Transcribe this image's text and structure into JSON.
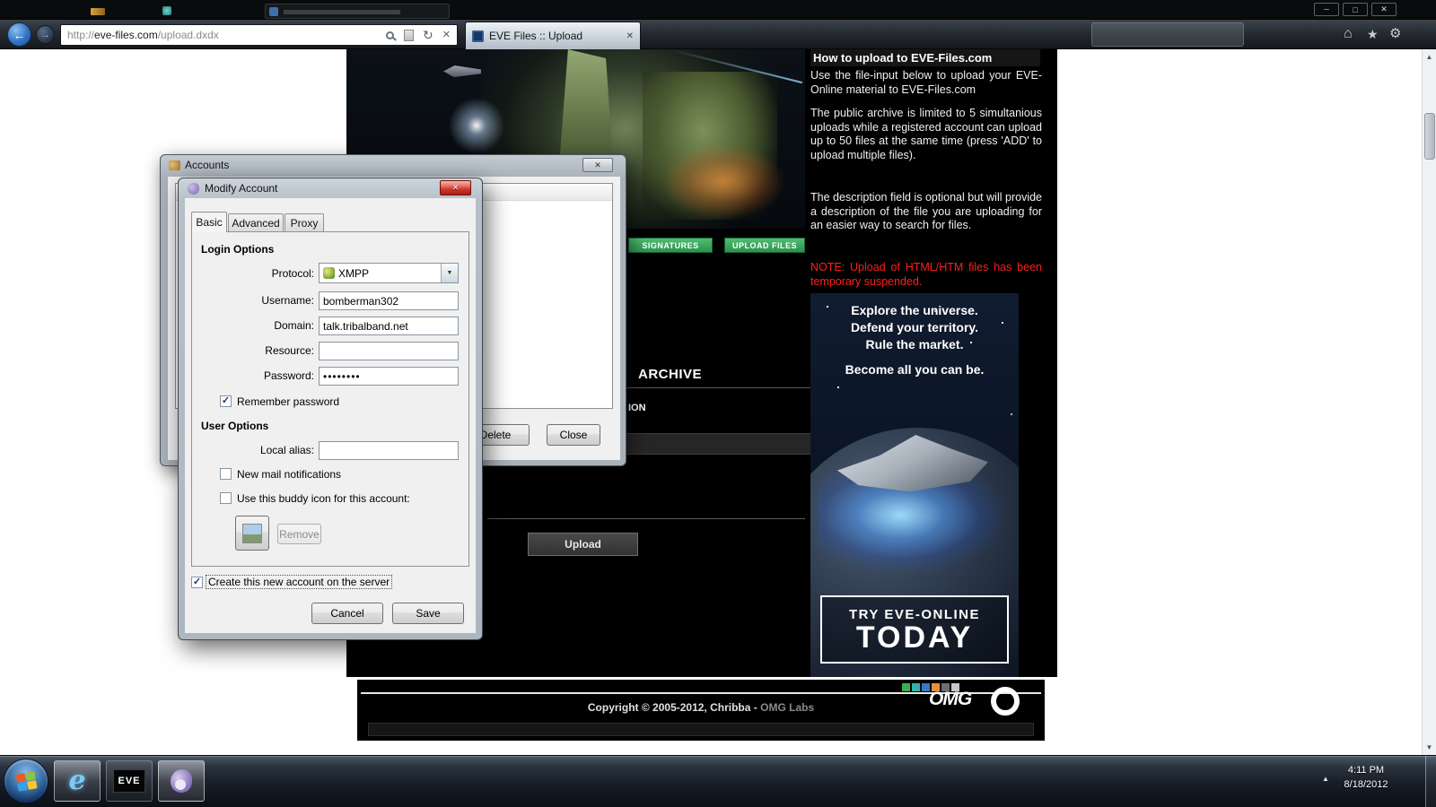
{
  "icons": {
    "minimize": "─",
    "maximize": "□",
    "close": "✕",
    "back_arrow": "←",
    "forward_arrow": "→",
    "refresh": "↻",
    "stop": "✕",
    "home": "⌂",
    "favorites_star": "★",
    "gear": "⚙",
    "dropdown_arrow": "▼",
    "checkmark": "✓",
    "scroll_up": "▲",
    "scroll_down": "▼",
    "tray_expand": "▲"
  },
  "browser": {
    "url_scheme": "http://",
    "url_host": "eve-files.com",
    "url_path": "/upload.dxdx",
    "tab_title": "EVE Files :: Upload"
  },
  "page": {
    "nav": {
      "signatures": "SIGNATURES",
      "upload_files": "UPLOAD FILES"
    },
    "archive_heading": "ARCHIVE",
    "description_partial": "ION",
    "upload_button": "Upload",
    "sidebar": {
      "heading": "How to upload to EVE-Files.com",
      "p1": "Use the file-input below to upload your EVE-Online material to EVE-Files.com",
      "p2": "The public archive is limited to 5 simultanious uploads while a registered account can upload up to 50 files at the same time (press 'ADD' to upload multiple files).",
      "p3": "The description field is optional but will provide a description of the file you are uploading for an easier way to search for files.",
      "note": "NOTE: Upload of HTML/HTM files has been temporary suspended."
    },
    "ad": {
      "line1": "Explore the universe.",
      "line2": "Defend your territory.",
      "line3": "Rule the market.",
      "line4": "Become all you can be.",
      "cta_line1": "TRY EVE-ONLINE",
      "cta_line2": "TODAY"
    },
    "footer": {
      "copyright": "Copyright © 2005-2012, Chribba -",
      "omg_labs": "OMG Labs",
      "omg_logo": "OMG"
    }
  },
  "accounts_window": {
    "title": "Accounts",
    "delete_button": "Delete",
    "close_button": "Close"
  },
  "modify_dialog": {
    "title": "Modify Account",
    "tabs": [
      "Basic",
      "Advanced",
      "Proxy"
    ],
    "login_heading": "Login Options",
    "protocol_label": "Protocol:",
    "protocol_value": "XMPP",
    "username_label": "Username:",
    "username_value": "bomberman302",
    "domain_label": "Domain:",
    "domain_value": "talk.tribalband.net",
    "resource_label": "Resource:",
    "resource_value": "",
    "password_label": "Password:",
    "password_value": "••••••••",
    "remember_password_label": "Remember password",
    "user_heading": "User Options",
    "local_alias_label": "Local alias:",
    "local_alias_value": "",
    "new_mail_label": "New mail notifications",
    "buddy_icon_label": "Use this buddy icon for this account:",
    "remove_button": "Remove",
    "create_account_label": "Create this new account on the server",
    "cancel_button": "Cancel",
    "save_button": "Save"
  },
  "taskbar": {
    "time": "4:11 PM",
    "date": "8/18/2012",
    "eve_icon_label": "EVE"
  },
  "colors": {
    "green_button": "#2c9150",
    "note_red": "#ff1f1f",
    "engine_glow": "#50a0ff",
    "close_button_red": "#cc372c",
    "taskbar_glass": "#161d26"
  }
}
